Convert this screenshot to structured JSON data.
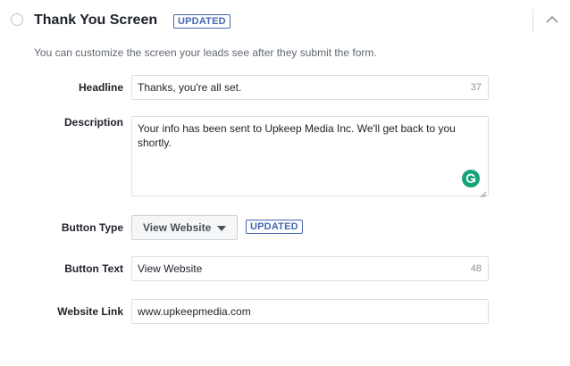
{
  "section": {
    "title": "Thank You Screen",
    "badge": "UPDATED",
    "description": "You can customize the screen your leads see after they submit the form."
  },
  "form": {
    "headline": {
      "label": "Headline",
      "value": "Thanks, you're all set.",
      "char_count": "37"
    },
    "description": {
      "label": "Description",
      "value": "Your info has been sent to Upkeep Media Inc. We'll get back to you shortly."
    },
    "button_type": {
      "label": "Button Type",
      "selected": "View Website",
      "badge": "UPDATED"
    },
    "button_text": {
      "label": "Button Text",
      "value": "View Website",
      "char_count": "48"
    },
    "website_link": {
      "label": "Website Link",
      "value": "www.upkeepmedia.com"
    }
  },
  "colors": {
    "accent": "#4267b2",
    "grammarly": "#15a479",
    "border": "#dddfe2",
    "muted_text": "#606770"
  },
  "icons": {
    "collapse": "chevron-up-icon",
    "grammarly": "grammarly-icon",
    "dropdown": "caret-down-icon"
  }
}
